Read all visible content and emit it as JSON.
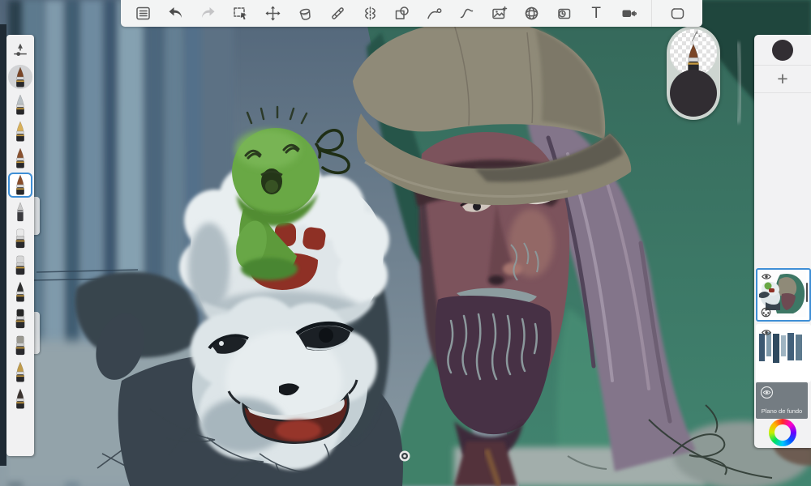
{
  "accent_color": "#3f8fd6",
  "toolbar": {
    "background": "#f3f4f4",
    "icon_color": "#5b5b5b",
    "disabled_icon_color": "#c4c4c6",
    "items": [
      "menu",
      "undo",
      "redo",
      "rect-select",
      "transform",
      "fill",
      "guides",
      "symmetry",
      "shapes",
      "predictive-stroke",
      "steady-stroke",
      "import-image",
      "perspective",
      "time-lapse",
      "text",
      "camera",
      "fullscreen"
    ],
    "text_tool_glyph": "T"
  },
  "left_panel": {
    "active_brush": {
      "name": "pointed-round-brush",
      "style": "color:#7a4526"
    },
    "brushes": [
      {
        "name": "airbrush",
        "style": "color:#b9c0c4"
      },
      {
        "name": "ink-pen-nib",
        "style": "color:#d8b05a"
      },
      {
        "name": "round-brush-brown",
        "style": "color:#8a5230"
      },
      {
        "name": "pointed-brush",
        "style": "color:#8a4f2c",
        "selected": true
      },
      {
        "name": "pencil",
        "style": "color:#c9c9c9"
      },
      {
        "name": "marker-white",
        "style": "color:#e9e9e9"
      },
      {
        "name": "marker-light",
        "style": "color:#d5d5d5"
      },
      {
        "name": "round-black",
        "style": "color:#2f2f2f"
      },
      {
        "name": "flat-black",
        "style": "color:#262626"
      },
      {
        "name": "chisel-gray",
        "style": "color:#9a9890"
      },
      {
        "name": "round-gold",
        "style": "color:#c09b4a"
      },
      {
        "name": "dark-round-brush",
        "style": "color:#3c3430"
      }
    ]
  },
  "puck": {
    "brush": "pointed-round-brush",
    "color_style": "background:#312d32"
  },
  "layers_panel": {
    "swatch_style": "background:#322e33",
    "add_label": "+",
    "layers": [
      {
        "id": "paint-layer",
        "visible": true,
        "selected": true
      },
      {
        "id": "sketch-layer",
        "visible": true,
        "selected": false
      },
      {
        "id": "background",
        "label": "Plano de fundo",
        "visible": true,
        "selected": false
      }
    ]
  },
  "canvas": {
    "palette": {
      "backdrop_slate": "#54687a",
      "tree_blue_dark": "#3c5871",
      "tree_blue_light": "#85a1b1",
      "bottom_wash": "#93a3aa",
      "coat_green": "#3d7765",
      "coat_green_dark": "#27493f",
      "cap_khaki": "#8f8a78",
      "cap_brim": "#898471",
      "skin_mauve": "#7c535c",
      "skin_shadow": "#3f2b33",
      "hair_violet": "#83748a",
      "beard_plum": "#473145",
      "beard_gray": "#93a4a6",
      "creature_white": "#e7edef",
      "creature_shade": "#a7b6bd",
      "silhouette_slate": "#39444e",
      "paw_red": "#8e3025",
      "frog_green": "#69a845",
      "mouth_red": "#5d241f"
    }
  }
}
